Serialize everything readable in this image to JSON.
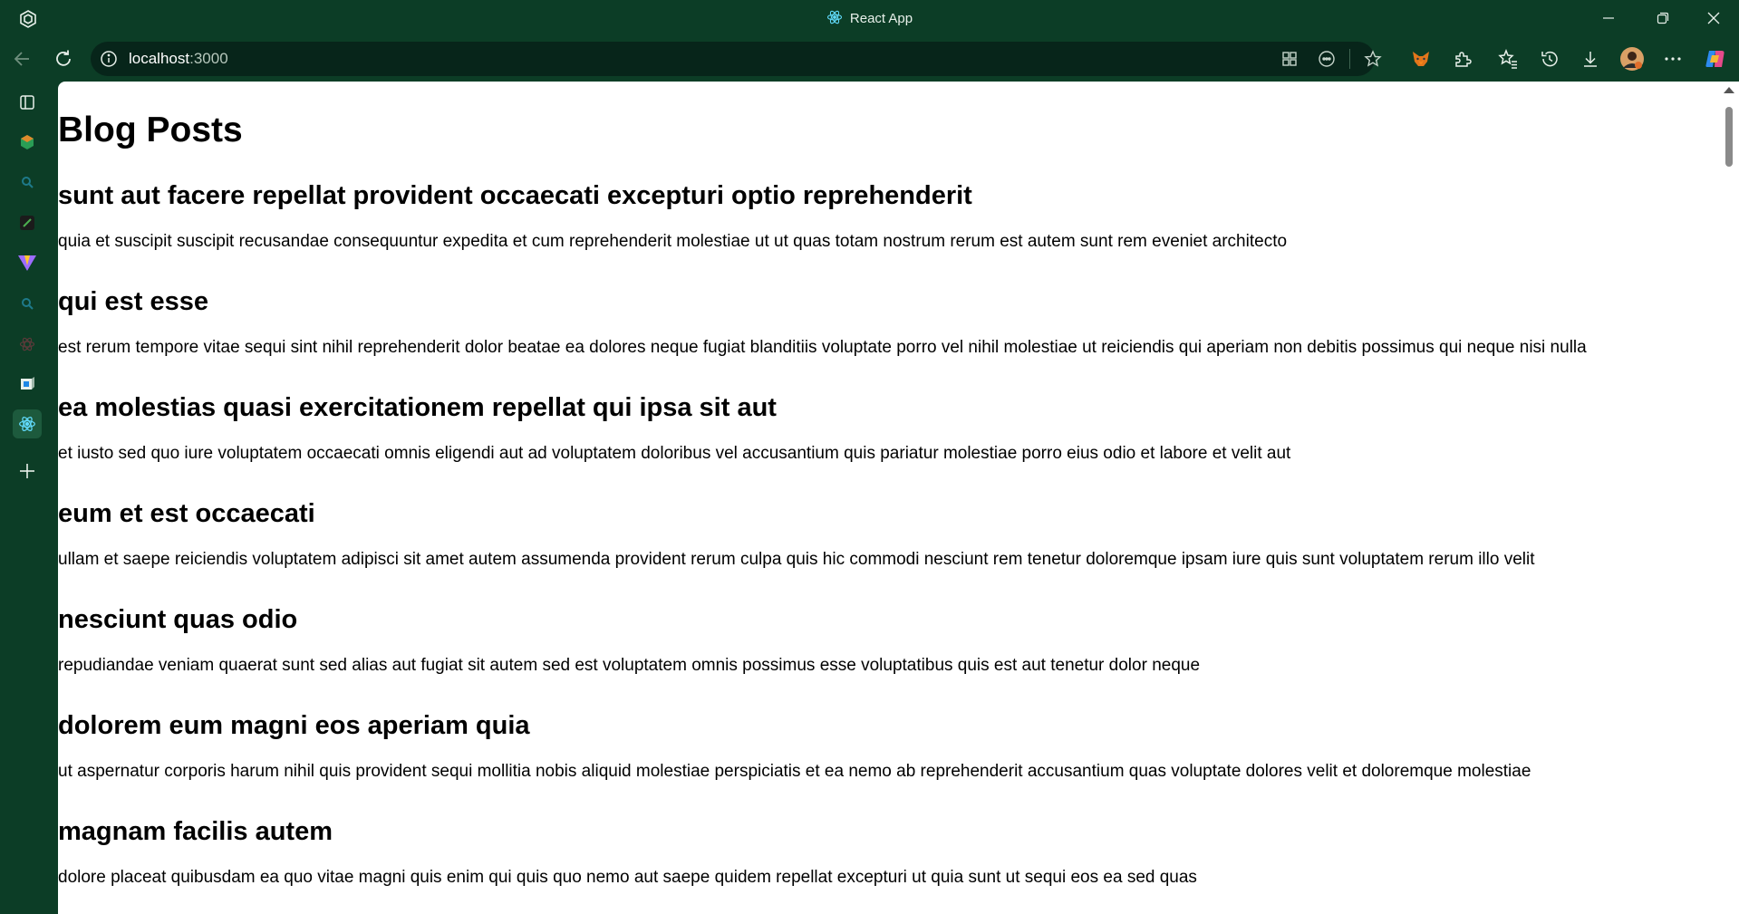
{
  "window": {
    "tab_title": "React App"
  },
  "toolbar": {
    "url_host": "localhost",
    "url_port": ":3000"
  },
  "page": {
    "title": "Blog Posts",
    "posts": [
      {
        "title": "sunt aut facere repellat provident occaecati excepturi optio reprehenderit",
        "body": "quia et suscipit suscipit recusandae consequuntur expedita et cum reprehenderit molestiae ut ut quas totam nostrum rerum est autem sunt rem eveniet architecto"
      },
      {
        "title": "qui est esse",
        "body": "est rerum tempore vitae sequi sint nihil reprehenderit dolor beatae ea dolores neque fugiat blanditiis voluptate porro vel nihil molestiae ut reiciendis qui aperiam non debitis possimus qui neque nisi nulla"
      },
      {
        "title": "ea molestias quasi exercitationem repellat qui ipsa sit aut",
        "body": "et iusto sed quo iure voluptatem occaecati omnis eligendi aut ad voluptatem doloribus vel accusantium quis pariatur molestiae porro eius odio et labore et velit aut"
      },
      {
        "title": "eum et est occaecati",
        "body": "ullam et saepe reiciendis voluptatem adipisci sit amet autem assumenda provident rerum culpa quis hic commodi nesciunt rem tenetur doloremque ipsam iure quis sunt voluptatem rerum illo velit"
      },
      {
        "title": "nesciunt quas odio",
        "body": "repudiandae veniam quaerat sunt sed alias aut fugiat sit autem sed est voluptatem omnis possimus esse voluptatibus quis est aut tenetur dolor neque"
      },
      {
        "title": "dolorem eum magni eos aperiam quia",
        "body": "ut aspernatur corporis harum nihil quis provident sequi mollitia nobis aliquid molestiae perspiciatis et ea nemo ab reprehenderit accusantium quas voluptate dolores velit et doloremque molestiae"
      },
      {
        "title": "magnam facilis autem",
        "body": "dolore placeat quibusdam ea quo vitae magni quis enim qui quis quo nemo aut saepe quidem repellat excepturi ut quia sunt ut sequi eos ea sed quas"
      }
    ]
  },
  "colors": {
    "browser_frame": "#0c3d26",
    "address_bar": "#07251a",
    "page_background": "#ffffff",
    "text": "#000000"
  },
  "icons": {
    "titlebar": [
      "workspaces-icon",
      "react-favicon-icon"
    ],
    "window_controls": [
      "minimize-icon",
      "restore-icon",
      "close-icon"
    ],
    "navigation": [
      "back-icon",
      "refresh-icon",
      "site-info-icon"
    ],
    "address_bar": [
      "app-available-icon",
      "read-aloud-icon",
      "favorite-star-icon"
    ],
    "toolbar": [
      "metamask-extension-icon",
      "extensions-icon",
      "favorites-icon",
      "history-icon",
      "downloads-icon",
      "profile-avatar",
      "more-menu-icon",
      "copilot-icon"
    ],
    "sidebar": [
      "tab-actions-icon",
      "sidebar-app-1-icon",
      "search-app-icon",
      "sidebar-app-2-icon",
      "vite-app-icon",
      "search-app-2-icon",
      "react-app-dim-icon",
      "sidebar-app-3-icon",
      "react-app-active-icon",
      "add-sidebar-app-icon"
    ]
  }
}
